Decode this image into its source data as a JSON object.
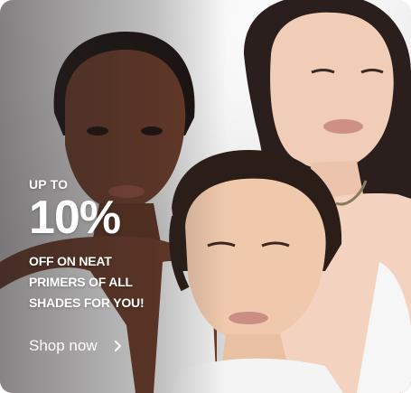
{
  "promo": {
    "eyebrow": "UP TO",
    "discount": "10%",
    "description": "OFF ON NEAT PRIMERS OF ALL SHADES FOR YOU!"
  },
  "cta": {
    "label": "Shop now",
    "icon": "chevron-right-icon"
  },
  "colors": {
    "text": "#ffffff",
    "background": "#e4e4e5"
  }
}
